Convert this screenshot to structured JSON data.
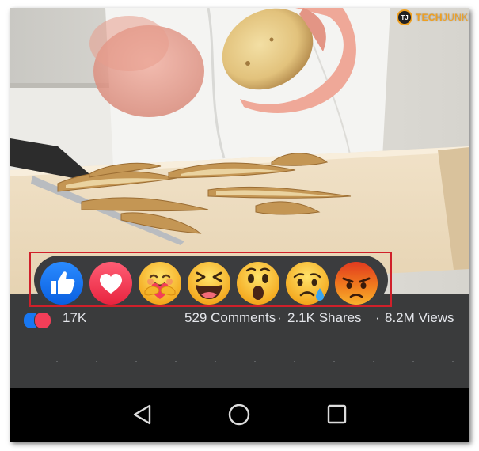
{
  "watermark": {
    "brand_prefix": "TECH",
    "brand_suffix": "JUNKIE",
    "logo_letters": "TJ",
    "accent": "#f0a020"
  },
  "post_stats": {
    "reaction_count": "17K",
    "comments": "529 Comments",
    "shares": "2.1K Shares",
    "separator": "·",
    "views": "8.2M Views"
  },
  "reactions": [
    {
      "name": "like",
      "color": "#1877f2"
    },
    {
      "name": "love",
      "color": "#f33e58"
    },
    {
      "name": "care",
      "color": "#f7b125"
    },
    {
      "name": "haha",
      "color": "#f7b125"
    },
    {
      "name": "wow",
      "color": "#f7b125"
    },
    {
      "name": "sad",
      "color": "#f7b125"
    },
    {
      "name": "angry",
      "color": "#e9710f"
    }
  ],
  "highlight_color": "#d0202a",
  "nav_bar": {
    "icons": [
      "back-icon",
      "home-icon",
      "recents-icon"
    ]
  }
}
